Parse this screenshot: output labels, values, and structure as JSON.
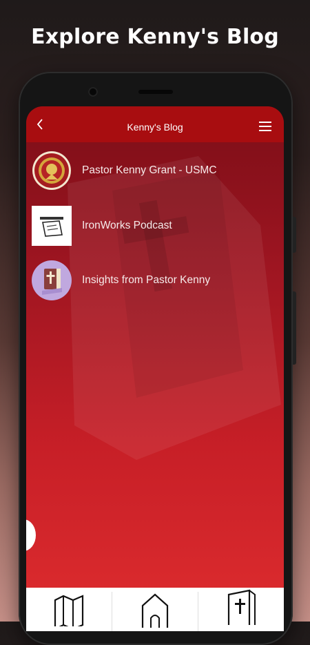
{
  "headline": "Explore Kenny's Blog",
  "app_bar": {
    "title": "Kenny's Blog",
    "back_icon": "chevron-left-icon",
    "menu_icon": "hamburger-menu-icon"
  },
  "blog_list": [
    {
      "label": "Pastor Kenny Grant - USMC",
      "thumb": "usmc-emblem-icon"
    },
    {
      "label": "IronWorks Podcast",
      "thumb": "ironworks-logo-icon"
    },
    {
      "label": "Insights from Pastor Kenny",
      "thumb": "bible-icon"
    }
  ],
  "bottom_nav": [
    {
      "icon": "map-icon"
    },
    {
      "icon": "church-icon"
    },
    {
      "icon": "bible-icon"
    }
  ],
  "colors": {
    "app_bar": "#a80d10",
    "screen_top": "#7c0e17",
    "screen_bottom": "#df2d2f",
    "text": "#ffffff"
  }
}
